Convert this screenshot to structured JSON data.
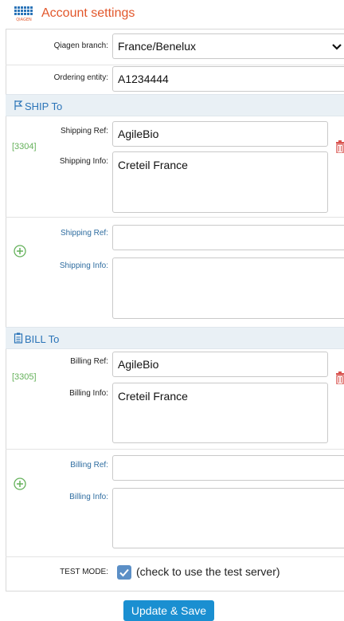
{
  "header": {
    "title": "Account settings",
    "logo_text": "QIAGEN"
  },
  "form": {
    "branch_label": "Qiagen branch:",
    "branch_value": "France/Benelux",
    "ordering_label": "Ordering entity:",
    "ordering_value": "A1234444"
  },
  "ship": {
    "title": "SHIP To",
    "code": "[3304]",
    "ref_label": "Shipping Ref:",
    "ref_value": "AgileBio",
    "info_label": "Shipping Info:",
    "info_value": "Creteil France",
    "new_ref_label": "Shipping Ref:",
    "new_info_label": "Shipping Info:",
    "new_ref_value": "",
    "new_info_value": ""
  },
  "bill": {
    "title": "BILL To",
    "code": "[3305]",
    "ref_label": "Billing Ref:",
    "ref_value": "AgileBio",
    "info_label": "Billing Info:",
    "info_value": "Creteil France",
    "new_ref_label": "Billing Ref:",
    "new_info_label": "Billing Info:",
    "new_ref_value": "",
    "new_info_value": ""
  },
  "test_mode": {
    "label": "TEST MODE:",
    "checked": true,
    "note": "(check to use the test server)"
  },
  "actions": {
    "save_label": "Update & Save"
  },
  "icons": {
    "logo": "qiagen-logo",
    "ship": "ship-to-flag-icon",
    "bill": "bill-to-clipboard-icon",
    "delete": "trash-icon",
    "add": "add-circle-icon",
    "dropdown": "chevron-down-icon",
    "check": "check-icon"
  },
  "colors": {
    "title": "#e2572b",
    "section_bg": "#e9f0f5",
    "section_text": "#2b74b8",
    "code": "#64b15a",
    "trash": "#d9534f",
    "button": "#1a8fd1"
  }
}
